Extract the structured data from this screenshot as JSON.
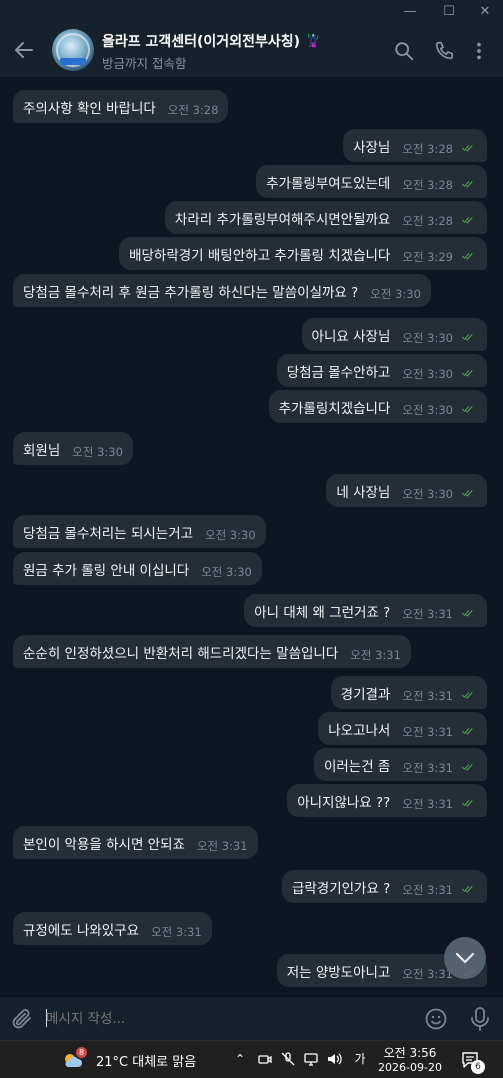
{
  "window": {
    "minimize": "—",
    "maximize": "☐",
    "close": "✕"
  },
  "header": {
    "title": "올라프 고객센터(이거외전부사칭) 🦹",
    "subtitle": "방금까지 접속함"
  },
  "messages": [
    {
      "dir": "in",
      "text": "주의사항 확인 바랍니다",
      "time": "오전 3:28"
    },
    {
      "dir": "out",
      "text": "사장님",
      "time": "오전 3:28"
    },
    {
      "dir": "out",
      "text": "추가롤링부여도있는데",
      "time": "오전 3:28"
    },
    {
      "dir": "out",
      "text": "차라리 추가롤링부여해주시면안될까요",
      "time": "오전 3:28"
    },
    {
      "dir": "out",
      "text": "배당하락경기 배팅안하고 추가롤링 치겠습니다",
      "time": "오전 3:29"
    },
    {
      "dir": "in",
      "text": "당첨금 몰수처리 후 원금 추가롤링 하신다는 말씀이실까요 ?",
      "time": "오전 3:30"
    },
    {
      "dir": "out",
      "text": "아니요 사장님",
      "time": "오전 3:30"
    },
    {
      "dir": "out",
      "text": "당첨금 몰수안하고",
      "time": "오전 3:30"
    },
    {
      "dir": "out",
      "text": "추가롤링치겠습니다",
      "time": "오전 3:30"
    },
    {
      "dir": "in",
      "text": "회원님",
      "time": "오전 3:30"
    },
    {
      "dir": "out",
      "text": "네 사장님",
      "time": "오전 3:30"
    },
    {
      "dir": "in",
      "text": "당첨금 몰수처리는 되시는거고",
      "time": "오전 3:30"
    },
    {
      "dir": "in",
      "text": "원금 추가 롤링 안내 이십니다",
      "time": "오전 3:30"
    },
    {
      "dir": "out",
      "text": "아니 대체 왜 그런거죠 ?",
      "time": "오전 3:31"
    },
    {
      "dir": "in",
      "text": "순순히 인정하셨으니 반환처리 해드리겠다는 말씀입니다",
      "time": "오전 3:31"
    },
    {
      "dir": "out",
      "text": "경기결과",
      "time": "오전 3:31"
    },
    {
      "dir": "out",
      "text": "나오고나서",
      "time": "오전 3:31"
    },
    {
      "dir": "out",
      "text": "이러는건 좀",
      "time": "오전 3:31"
    },
    {
      "dir": "out",
      "text": "아니지않나요 ??",
      "time": "오전 3:31"
    },
    {
      "dir": "in",
      "text": "본인이 악용을 하시면 안되죠",
      "time": "오전 3:31"
    },
    {
      "dir": "out",
      "text": "급락경기인가요 ?",
      "time": "오전 3:31"
    },
    {
      "dir": "in",
      "text": "규정에도 나와있구요",
      "time": "오전 3:31"
    },
    {
      "dir": "out",
      "text": "저는 양방도아니고",
      "time": "오전 3:31"
    }
  ],
  "composer": {
    "placeholder": "메시지 작성..."
  },
  "taskbar": {
    "weather_badge": "8",
    "weather": "21°C  대체로 맑음",
    "ime": "가",
    "time": "오전 3:56",
    "date": "2026-09-20",
    "notifications": "6"
  },
  "colors": {
    "background": "#0e1621",
    "bubble": "#252d36",
    "header": "#17212b",
    "read_ticks": "#4fae4e"
  }
}
